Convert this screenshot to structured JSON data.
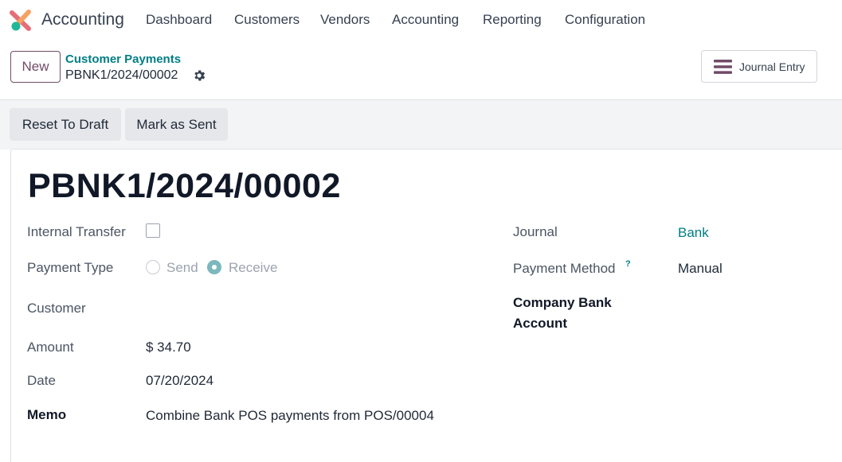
{
  "app": {
    "name": "Accounting"
  },
  "nav": {
    "items": [
      "Dashboard",
      "Customers",
      "Vendors",
      "Accounting",
      "Reporting",
      "Configuration"
    ]
  },
  "control": {
    "new_label": "New",
    "breadcrumb_parent": "Customer Payments",
    "breadcrumb_current": "PBNK1/2024/00002",
    "journal_entry_label": "Journal Entry"
  },
  "status_actions": {
    "reset_label": "Reset To Draft",
    "mark_sent_label": "Mark as Sent"
  },
  "form": {
    "title": "PBNK1/2024/00002",
    "internal_transfer": {
      "label": "Internal Transfer",
      "checked": false
    },
    "payment_type": {
      "label": "Payment Type",
      "options": [
        "Send",
        "Receive"
      ],
      "selected": "Receive"
    },
    "customer": {
      "label": "Customer",
      "value": ""
    },
    "amount": {
      "label": "Amount",
      "value": "$ 34.70"
    },
    "date": {
      "label": "Date",
      "value": "07/20/2024"
    },
    "memo": {
      "label": "Memo",
      "value": "Combine Bank POS payments from POS/00004"
    },
    "journal": {
      "label": "Journal",
      "value": "Bank"
    },
    "payment_method": {
      "label": "Payment Method",
      "help": "?",
      "value": "Manual"
    },
    "company_bank_account": {
      "label_line1": "Company Bank",
      "label_line2": "Account",
      "value": ""
    }
  },
  "colors": {
    "brand": "#714b67",
    "link": "#017e84",
    "radio_selected": "#7cb8bd"
  },
  "icons": {
    "logo": "odoo-accounting-logo",
    "gear": "gear-icon",
    "menu": "hamburger-icon"
  }
}
